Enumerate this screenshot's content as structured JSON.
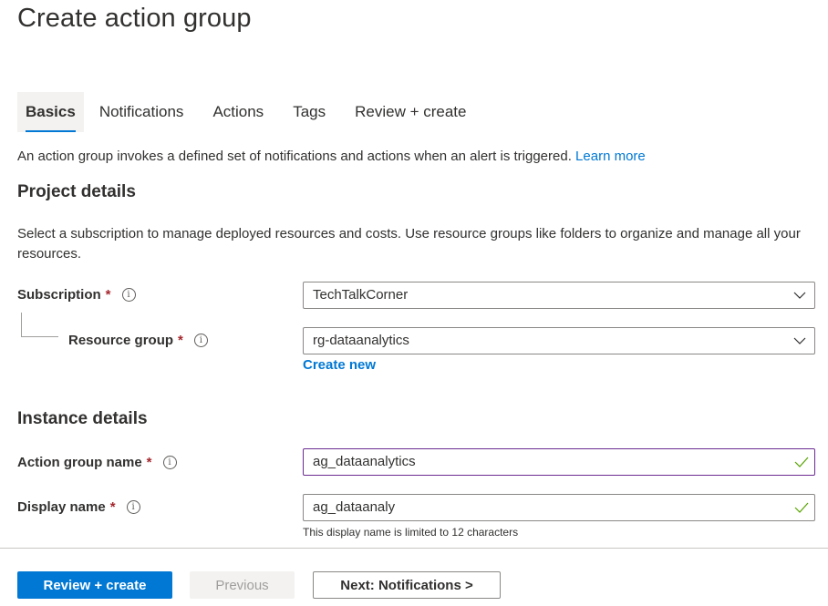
{
  "page": {
    "title": "Create action group"
  },
  "tabs": [
    {
      "label": "Basics",
      "active": true
    },
    {
      "label": "Notifications",
      "active": false
    },
    {
      "label": "Actions",
      "active": false
    },
    {
      "label": "Tags",
      "active": false
    },
    {
      "label": "Review + create",
      "active": false
    }
  ],
  "intro": {
    "text": "An action group invokes a defined set of notifications and actions when an alert is triggered.",
    "link": "Learn more"
  },
  "project": {
    "heading": "Project details",
    "description": "Select a subscription to manage deployed resources and costs. Use resource groups like folders to organize and manage all your resources.",
    "subscription": {
      "label": "Subscription",
      "required": "*",
      "value": "TechTalkCorner"
    },
    "resource_group": {
      "label": "Resource group",
      "required": "*",
      "value": "rg-dataanalytics",
      "create_new": "Create new"
    }
  },
  "instance": {
    "heading": "Instance details",
    "action_group_name": {
      "label": "Action group name",
      "required": "*",
      "value": "ag_dataanalytics",
      "valid": true
    },
    "display_name": {
      "label": "Display name",
      "required": "*",
      "value": "ag_dataanaly",
      "valid": true,
      "hint": "This display name is limited to 12 characters"
    }
  },
  "footer": {
    "review_create": "Review + create",
    "previous": "Previous",
    "next": "Next: Notifications >"
  },
  "icons": {
    "info": "i"
  },
  "colors": {
    "accent": "#0078d4",
    "required": "#a4262c",
    "focus_border": "#6b2c91",
    "valid_check": "#57a300"
  }
}
